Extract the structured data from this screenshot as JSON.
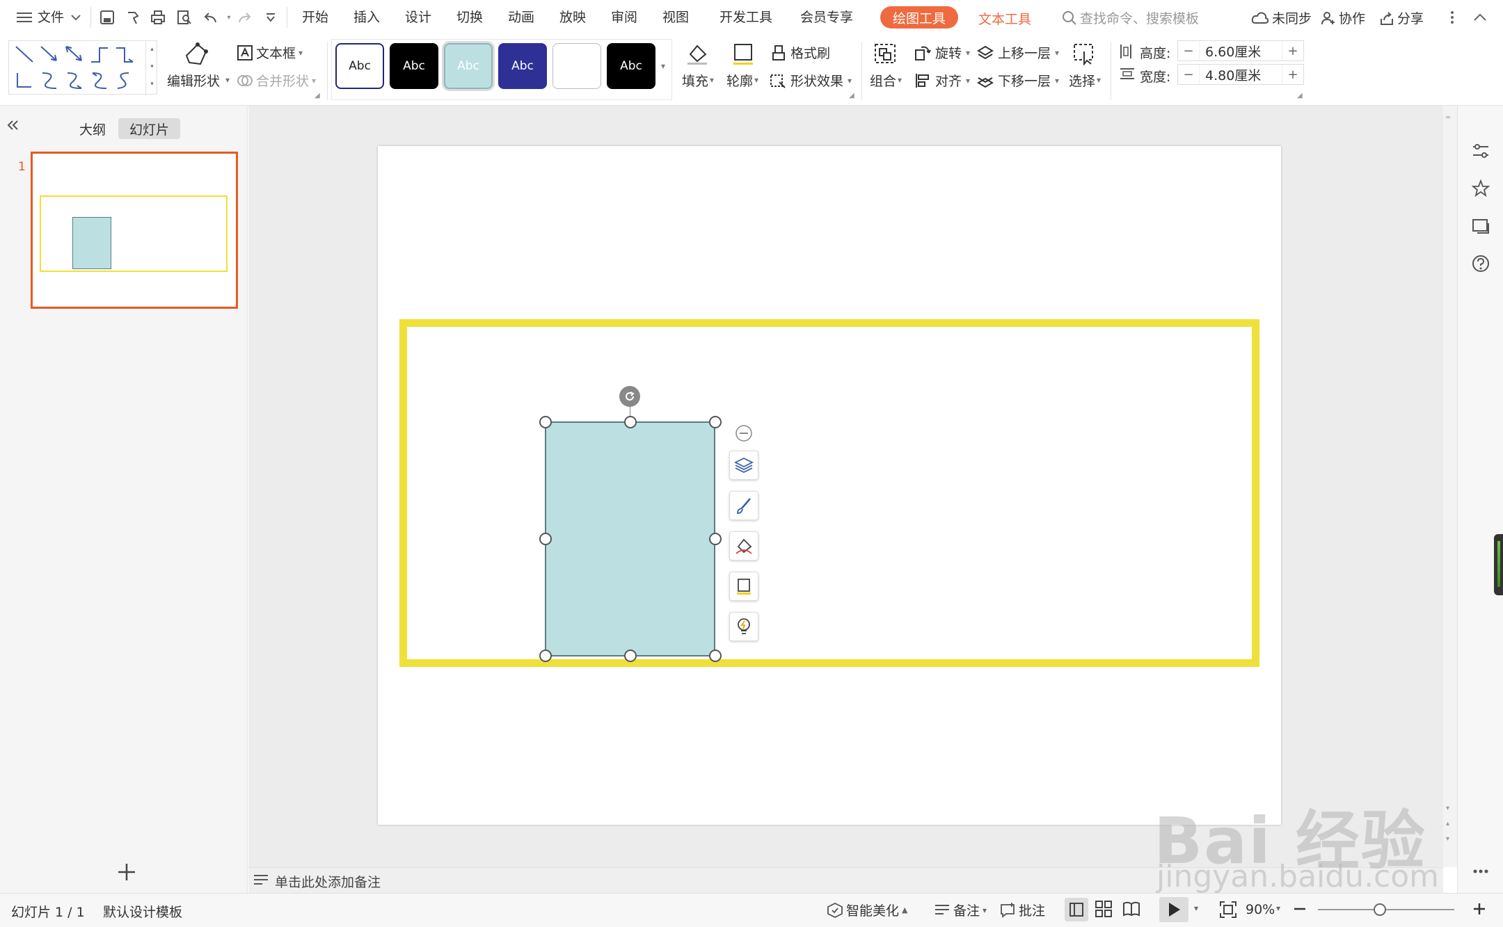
{
  "menubar": {
    "file_label": "文件",
    "tabs": [
      "开始",
      "插入",
      "设计",
      "切换",
      "动画",
      "放映",
      "审阅",
      "视图",
      "开发工具",
      "会员专享"
    ],
    "active_tab": "绘图工具",
    "text_tool_tab": "文本工具",
    "search_placeholder": "查找命令、搜索模板",
    "sync_label": "未同步",
    "collab_label": "协作",
    "share_label": "分享"
  },
  "ribbon": {
    "edit_shape": "编辑形状",
    "textbox": "文本框",
    "merge_shape": "合并形状",
    "style_text": "Abc",
    "fill": "填充",
    "outline": "轮廓",
    "format_painter": "格式刷",
    "shape_effect": "形状效果",
    "group": "组合",
    "rotate": "旋转",
    "align": "对齐",
    "bring_forward": "上移一层",
    "send_backward": "下移一层",
    "select": "选择",
    "height_label": "高度:",
    "height_value": "6.60厘米",
    "width_label": "宽度:",
    "width_value": "4.80厘米"
  },
  "left_panel": {
    "outline_tab": "大纲",
    "slides_tab": "幻灯片",
    "slide_number": "1"
  },
  "notes": {
    "placeholder": "单击此处添加备注"
  },
  "statusbar": {
    "slide_info": "幻灯片 1 / 1",
    "template": "默认设计模板",
    "smart_beautify": "智能美化",
    "notes": "备注",
    "comments": "批注",
    "zoom": "90%"
  },
  "watermark": {
    "brand": "Bai 经验",
    "url": "jingyan.baidu.com"
  },
  "colors": {
    "accent_orange": "#f06a3f",
    "frame_yellow": "#f0e03a",
    "shape_fill": "#bce0e2"
  },
  "icons": {
    "float_toolbar": [
      "minus-circle-icon",
      "layers-icon",
      "brush-icon",
      "fill-icon",
      "outline-icon",
      "bulb-icon"
    ],
    "right_sidebar": [
      "settings-sliders-icon",
      "star-pin-icon",
      "slides-icon",
      "help-icon"
    ]
  }
}
